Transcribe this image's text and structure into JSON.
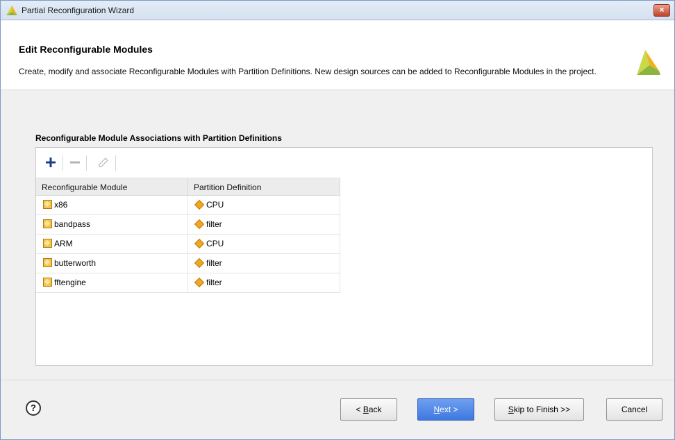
{
  "window": {
    "title": "Partial Reconfiguration Wizard",
    "close_label": "×"
  },
  "header": {
    "heading": "Edit Reconfigurable Modules",
    "description": "Create, modify and associate Reconfigurable Modules with Partition Definitions. New design sources can be added to Reconfigurable Modules in the project."
  },
  "section": {
    "title": "Reconfigurable Module Associations with Partition Definitions"
  },
  "toolbar": {
    "add_icon": "plus-icon",
    "remove_icon": "minus-icon",
    "edit_icon": "pencil-icon"
  },
  "table": {
    "columns": [
      "Reconfigurable Module",
      "Partition Definition"
    ],
    "rows": [
      {
        "module": "x86",
        "partition": "CPU"
      },
      {
        "module": "bandpass",
        "partition": "filter"
      },
      {
        "module": "ARM",
        "partition": "CPU"
      },
      {
        "module": "butterworth",
        "partition": "filter"
      },
      {
        "module": "fftengine",
        "partition": "filter"
      }
    ]
  },
  "footer": {
    "help_label": "?",
    "back_key": "B",
    "back_pre": "< ",
    "back_rest": "ack",
    "next_key": "N",
    "next_rest": "ext >",
    "skip_key": "S",
    "skip_rest": "kip to Finish >>",
    "cancel_label": "Cancel"
  },
  "colors": {
    "accent": "#3e78e0",
    "logo": "#8bb53c",
    "icon": "#f0a81f"
  }
}
